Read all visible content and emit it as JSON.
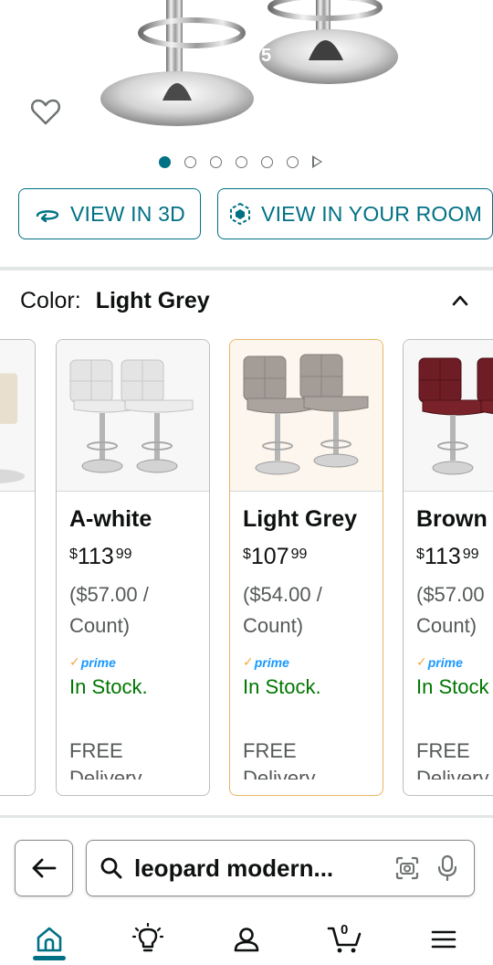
{
  "product_gallery": {
    "image_counter": "5",
    "active_dot": 0,
    "dot_count": 6,
    "wishlist_icon": "heart-outline-icon"
  },
  "buttons": {
    "view_3d": "VIEW IN 3D",
    "view_room": "VIEW IN YOUR ROOM"
  },
  "color_selector": {
    "label": "Color:",
    "selected": "Light Grey",
    "options": [
      {
        "name": "A-white",
        "currency": "$",
        "whole": "113",
        "cents": "99",
        "unit_line1": "($57.00 /",
        "unit_line2": "Count)",
        "prime": "prime",
        "stock": "In Stock.",
        "shipping": "FREE",
        "delivery": "Delivery"
      },
      {
        "name": "Light Grey",
        "currency": "$",
        "whole": "107",
        "cents": "99",
        "unit_line1": "($54.00 /",
        "unit_line2": "Count)",
        "prime": "prime",
        "stock": "In Stock.",
        "shipping": "FREE",
        "delivery": "Delivery"
      },
      {
        "name": "Brown",
        "currency": "$",
        "whole": "113",
        "cents": "99",
        "unit_line1": "($57.00",
        "unit_line2": "Count)",
        "prime": "prime",
        "stock": "In Stock",
        "shipping": "FREE",
        "delivery": "Delivery"
      }
    ]
  },
  "search": {
    "query": "leopard modern..."
  },
  "colors": {
    "accent": "#007185",
    "in_stock": "#007600",
    "selected_border": "#e7b760",
    "prime_blue": "#1a98ff"
  }
}
